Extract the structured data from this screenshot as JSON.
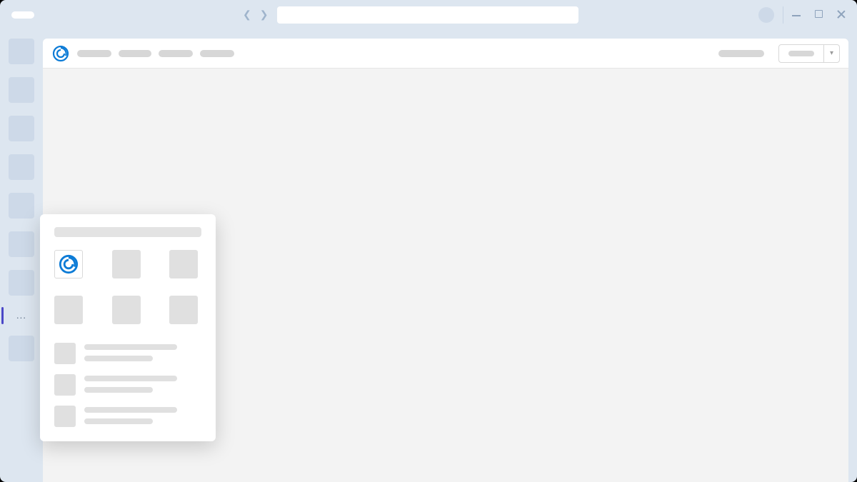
{
  "window": {
    "address": "",
    "controls": {
      "minimize": "min",
      "maximize": "max",
      "close": "close"
    }
  },
  "rail": {
    "items": [
      "",
      "",
      "",
      "",
      "",
      "",
      ""
    ],
    "overflow_label": "...",
    "trailing_items": [
      ""
    ]
  },
  "topbar": {
    "nav": [
      "",
      "",
      "",
      ""
    ],
    "right_text": "",
    "dropdown_label": ""
  },
  "popover": {
    "header": "",
    "grid": [
      "app-logo",
      "",
      "",
      "",
      "",
      ""
    ],
    "list": [
      {
        "line1": "",
        "line2": ""
      },
      {
        "line1": "",
        "line2": ""
      },
      {
        "line1": "",
        "line2": ""
      }
    ]
  }
}
